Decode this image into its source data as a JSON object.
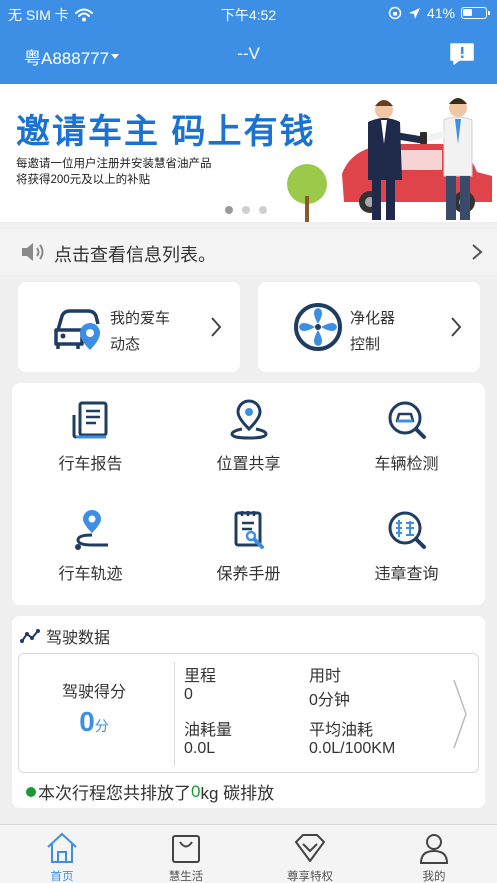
{
  "status_bar": {
    "carrier": "无 SIM 卡",
    "time": "下午4:52",
    "battery": "41%"
  },
  "nav": {
    "plate": "粤A888777",
    "title": "--V"
  },
  "banner": {
    "title": "邀请车主 码上有钱",
    "subtitle_line1": "每邀请一位用户注册并安装慧省油产品",
    "subtitle_line2": "将获得200元及以上的补贴",
    "page_count": 3,
    "active_page": 1
  },
  "notice": {
    "text": "点击查看信息列表。"
  },
  "quick_cards": [
    {
      "line1": "我的爱车",
      "line2": "动态",
      "icon": "car-pin-icon"
    },
    {
      "line1": "净化器",
      "line2": "控制",
      "icon": "fan-icon"
    }
  ],
  "grid_items": [
    {
      "label": "行车报告",
      "icon": "report-icon"
    },
    {
      "label": "位置共享",
      "icon": "location-share-icon"
    },
    {
      "label": "车辆检测",
      "icon": "car-inspect-icon"
    },
    {
      "label": "行车轨迹",
      "icon": "track-icon"
    },
    {
      "label": "保养手册",
      "icon": "manual-icon"
    },
    {
      "label": "违章查询",
      "icon": "violation-query-icon"
    }
  ],
  "driving_data": {
    "heading": "驾驶数据",
    "score_label": "驾驶得分",
    "score_value": "0",
    "score_unit": "分",
    "mileage_label": "里程",
    "mileage_value": "0",
    "duration_label": "用时",
    "duration_value": "0分钟",
    "fuel_label": "油耗量",
    "fuel_value": "0.0L",
    "avg_fuel_label": "平均油耗",
    "avg_fuel_value": "0.0L/100KM",
    "emission_prefix": "本次行程您共排放了",
    "emission_value": "0",
    "emission_suffix": "kg 碳排放"
  },
  "tabs": [
    {
      "label": "首页",
      "icon": "home-icon",
      "active": true
    },
    {
      "label": "慧生活",
      "icon": "shopping-bag-icon",
      "active": false
    },
    {
      "label": "尊享特权",
      "icon": "diamond-icon",
      "active": false
    },
    {
      "label": "我的",
      "icon": "user-icon",
      "active": false
    }
  ],
  "colors": {
    "brand_blue": "#3d8fe6",
    "banner_title": "#1a73d1",
    "emission_green": "#1a9a36",
    "icon_navy": "#1f3c63"
  }
}
